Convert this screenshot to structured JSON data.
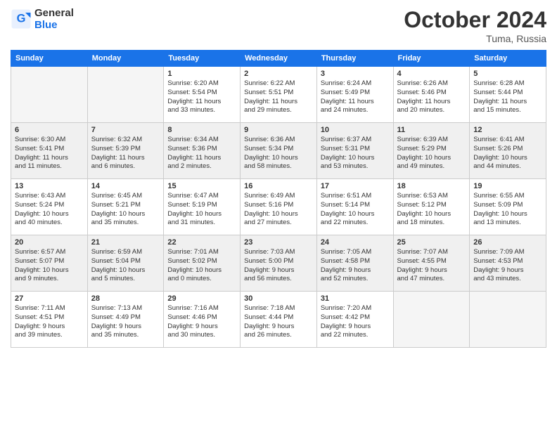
{
  "logo": {
    "line1": "General",
    "line2": "Blue"
  },
  "title": "October 2024",
  "location": "Tuma, Russia",
  "days_header": [
    "Sunday",
    "Monday",
    "Tuesday",
    "Wednesday",
    "Thursday",
    "Friday",
    "Saturday"
  ],
  "weeks": [
    [
      {
        "num": "",
        "info": ""
      },
      {
        "num": "",
        "info": ""
      },
      {
        "num": "1",
        "info": "Sunrise: 6:20 AM\nSunset: 5:54 PM\nDaylight: 11 hours\nand 33 minutes."
      },
      {
        "num": "2",
        "info": "Sunrise: 6:22 AM\nSunset: 5:51 PM\nDaylight: 11 hours\nand 29 minutes."
      },
      {
        "num": "3",
        "info": "Sunrise: 6:24 AM\nSunset: 5:49 PM\nDaylight: 11 hours\nand 24 minutes."
      },
      {
        "num": "4",
        "info": "Sunrise: 6:26 AM\nSunset: 5:46 PM\nDaylight: 11 hours\nand 20 minutes."
      },
      {
        "num": "5",
        "info": "Sunrise: 6:28 AM\nSunset: 5:44 PM\nDaylight: 11 hours\nand 15 minutes."
      }
    ],
    [
      {
        "num": "6",
        "info": "Sunrise: 6:30 AM\nSunset: 5:41 PM\nDaylight: 11 hours\nand 11 minutes."
      },
      {
        "num": "7",
        "info": "Sunrise: 6:32 AM\nSunset: 5:39 PM\nDaylight: 11 hours\nand 6 minutes."
      },
      {
        "num": "8",
        "info": "Sunrise: 6:34 AM\nSunset: 5:36 PM\nDaylight: 11 hours\nand 2 minutes."
      },
      {
        "num": "9",
        "info": "Sunrise: 6:36 AM\nSunset: 5:34 PM\nDaylight: 10 hours\nand 58 minutes."
      },
      {
        "num": "10",
        "info": "Sunrise: 6:37 AM\nSunset: 5:31 PM\nDaylight: 10 hours\nand 53 minutes."
      },
      {
        "num": "11",
        "info": "Sunrise: 6:39 AM\nSunset: 5:29 PM\nDaylight: 10 hours\nand 49 minutes."
      },
      {
        "num": "12",
        "info": "Sunrise: 6:41 AM\nSunset: 5:26 PM\nDaylight: 10 hours\nand 44 minutes."
      }
    ],
    [
      {
        "num": "13",
        "info": "Sunrise: 6:43 AM\nSunset: 5:24 PM\nDaylight: 10 hours\nand 40 minutes."
      },
      {
        "num": "14",
        "info": "Sunrise: 6:45 AM\nSunset: 5:21 PM\nDaylight: 10 hours\nand 35 minutes."
      },
      {
        "num": "15",
        "info": "Sunrise: 6:47 AM\nSunset: 5:19 PM\nDaylight: 10 hours\nand 31 minutes."
      },
      {
        "num": "16",
        "info": "Sunrise: 6:49 AM\nSunset: 5:16 PM\nDaylight: 10 hours\nand 27 minutes."
      },
      {
        "num": "17",
        "info": "Sunrise: 6:51 AM\nSunset: 5:14 PM\nDaylight: 10 hours\nand 22 minutes."
      },
      {
        "num": "18",
        "info": "Sunrise: 6:53 AM\nSunset: 5:12 PM\nDaylight: 10 hours\nand 18 minutes."
      },
      {
        "num": "19",
        "info": "Sunrise: 6:55 AM\nSunset: 5:09 PM\nDaylight: 10 hours\nand 13 minutes."
      }
    ],
    [
      {
        "num": "20",
        "info": "Sunrise: 6:57 AM\nSunset: 5:07 PM\nDaylight: 10 hours\nand 9 minutes."
      },
      {
        "num": "21",
        "info": "Sunrise: 6:59 AM\nSunset: 5:04 PM\nDaylight: 10 hours\nand 5 minutes."
      },
      {
        "num": "22",
        "info": "Sunrise: 7:01 AM\nSunset: 5:02 PM\nDaylight: 10 hours\nand 0 minutes."
      },
      {
        "num": "23",
        "info": "Sunrise: 7:03 AM\nSunset: 5:00 PM\nDaylight: 9 hours\nand 56 minutes."
      },
      {
        "num": "24",
        "info": "Sunrise: 7:05 AM\nSunset: 4:58 PM\nDaylight: 9 hours\nand 52 minutes."
      },
      {
        "num": "25",
        "info": "Sunrise: 7:07 AM\nSunset: 4:55 PM\nDaylight: 9 hours\nand 47 minutes."
      },
      {
        "num": "26",
        "info": "Sunrise: 7:09 AM\nSunset: 4:53 PM\nDaylight: 9 hours\nand 43 minutes."
      }
    ],
    [
      {
        "num": "27",
        "info": "Sunrise: 7:11 AM\nSunset: 4:51 PM\nDaylight: 9 hours\nand 39 minutes."
      },
      {
        "num": "28",
        "info": "Sunrise: 7:13 AM\nSunset: 4:49 PM\nDaylight: 9 hours\nand 35 minutes."
      },
      {
        "num": "29",
        "info": "Sunrise: 7:16 AM\nSunset: 4:46 PM\nDaylight: 9 hours\nand 30 minutes."
      },
      {
        "num": "30",
        "info": "Sunrise: 7:18 AM\nSunset: 4:44 PM\nDaylight: 9 hours\nand 26 minutes."
      },
      {
        "num": "31",
        "info": "Sunrise: 7:20 AM\nSunset: 4:42 PM\nDaylight: 9 hours\nand 22 minutes."
      },
      {
        "num": "",
        "info": ""
      },
      {
        "num": "",
        "info": ""
      }
    ]
  ]
}
